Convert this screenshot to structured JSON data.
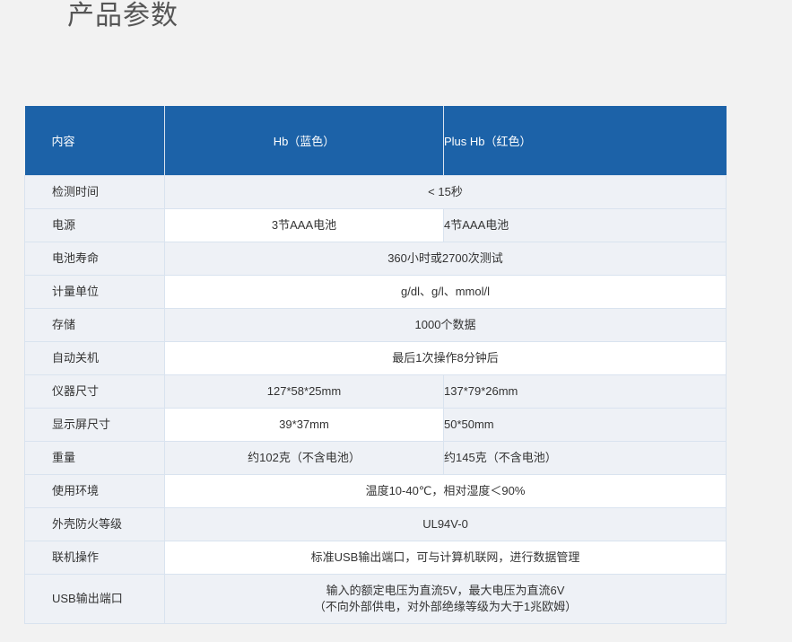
{
  "page": {
    "title": "产品参数"
  },
  "table": {
    "headers": {
      "col1": "内容",
      "col2": "Hb（蓝色）",
      "col3": "Plus Hb（红色）"
    },
    "rows": {
      "test_time": {
        "label": "检测时间",
        "value": "< 15秒"
      },
      "power": {
        "label": "电源",
        "hb": "3节AAA电池",
        "plus": "4节AAA电池"
      },
      "battery_life": {
        "label": "电池寿命",
        "value": "360小时或2700次测试"
      },
      "units": {
        "label": "计量单位",
        "value": "g/dl、g/l、mmol/l"
      },
      "storage": {
        "label": "存储",
        "value": "1000个数据"
      },
      "auto_off": {
        "label": "自动关机",
        "value": "最后1次操作8分钟后"
      },
      "device_size": {
        "label": "仪器尺寸",
        "hb": "127*58*25mm",
        "plus": "137*79*26mm"
      },
      "screen_size": {
        "label": "显示屏尺寸",
        "hb": "39*37mm",
        "plus": "50*50mm"
      },
      "weight": {
        "label": "重量",
        "hb": "约102克（不含电池）",
        "plus": "约145克（不含电池）"
      },
      "environment": {
        "label": "使用环境",
        "value": "温度10-40℃，相对湿度＜90%"
      },
      "fire_rating": {
        "label": "外壳防火等级",
        "value": "UL94V-0"
      },
      "online": {
        "label": "联机操作",
        "value": "标准USB输出端口，可与计算机联网，进行数据管理"
      },
      "usb": {
        "label": "USB输出端口",
        "line1": "输入的额定电压为直流5V，最大电压为直流6V",
        "line2": "（不向外部供电，对外部绝缘等级为大于1兆欧姆）"
      }
    }
  }
}
